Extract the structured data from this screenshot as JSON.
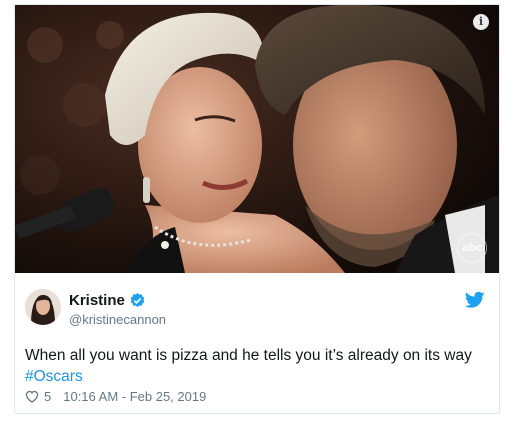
{
  "media": {
    "info_icon_glyph": "i",
    "watermark": "abc"
  },
  "author": {
    "display_name": "Kristine",
    "handle": "@kristinecannon",
    "verified": true
  },
  "tweet": {
    "text_before": "When all you want is pizza and he tells you it’s already on its way ",
    "hashtag": "#Oscars"
  },
  "footer": {
    "like_count": "5",
    "timestamp": "10:16 AM - Feb 25, 2019"
  },
  "colors": {
    "link": "#1b95e0",
    "verified": "#1da1f2",
    "twitter_bird": "#1da1f2",
    "secondary_text": "#657786",
    "primary_text": "#14171a",
    "border": "#e1e8ed"
  },
  "icons": {
    "info": "info-icon",
    "verified": "verified-badge-icon",
    "bird": "twitter-bird-icon",
    "like": "heart-icon"
  }
}
